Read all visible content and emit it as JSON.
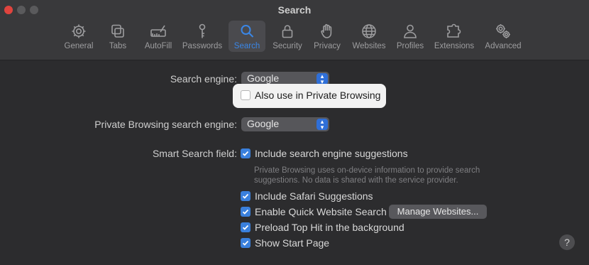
{
  "window": {
    "title": "Search"
  },
  "tabs": [
    {
      "label": "General",
      "icon": "gear-icon"
    },
    {
      "label": "Tabs",
      "icon": "tabs-icon"
    },
    {
      "label": "AutoFill",
      "icon": "autofill-icon"
    },
    {
      "label": "Passwords",
      "icon": "key-icon"
    },
    {
      "label": "Search",
      "icon": "search-icon",
      "active": true
    },
    {
      "label": "Security",
      "icon": "lock-icon"
    },
    {
      "label": "Privacy",
      "icon": "hand-icon"
    },
    {
      "label": "Websites",
      "icon": "globe-icon"
    },
    {
      "label": "Profiles",
      "icon": "person-icon"
    },
    {
      "label": "Extensions",
      "icon": "puzzle-icon"
    },
    {
      "label": "Advanced",
      "icon": "gears-icon"
    }
  ],
  "search": {
    "engine_label": "Search engine:",
    "engine_value": "Google",
    "also_private_label": "Also use in Private Browsing",
    "also_private_checked": false,
    "private_engine_label": "Private Browsing search engine:",
    "private_engine_value": "Google"
  },
  "smart": {
    "label": "Smart Search field:",
    "options": [
      {
        "label": "Include search engine suggestions",
        "checked": true
      },
      {
        "label": "Include Safari Suggestions",
        "checked": true
      },
      {
        "label": "Enable Quick Website Search",
        "checked": true
      },
      {
        "label": "Preload Top Hit in the background",
        "checked": true
      },
      {
        "label": "Show Start Page",
        "checked": true
      }
    ],
    "note": "Private Browsing uses on-device information to provide search suggestions. No data is shared with the service provider.",
    "manage_button": "Manage Websites..."
  },
  "help": {
    "label": "?"
  },
  "colors": {
    "accent": "#3a80dd",
    "active_tab_text": "#3a86e6",
    "highlight": "#f2f2f2"
  }
}
